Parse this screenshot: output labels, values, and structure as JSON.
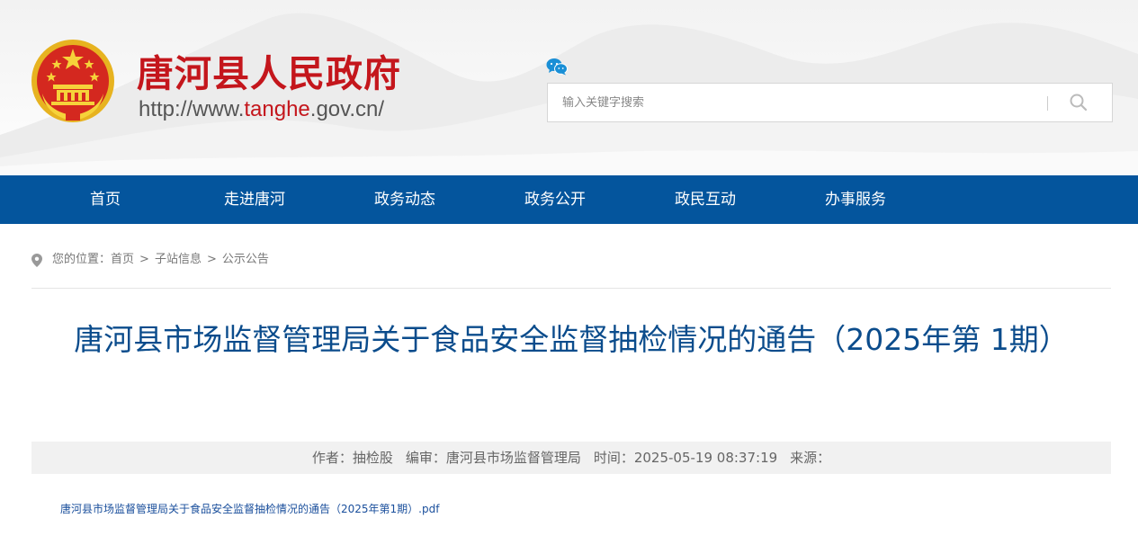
{
  "header": {
    "site_name": "唐河县人民政府",
    "url_prefix": "http://www.",
    "url_highlight": "tanghe",
    "url_suffix": ".gov.cn/",
    "search": {
      "placeholder": "输入关键字搜索"
    }
  },
  "icons": {
    "emblem": "national-emblem-icon",
    "wechat": "wechat-icon",
    "search": "search-icon",
    "location": "location-pin-icon"
  },
  "colors": {
    "brand_red": "#c4161c",
    "nav_blue": "#04559d",
    "title_blue": "#0b4c8c",
    "link_blue": "#1a4f9c"
  },
  "nav": {
    "items": [
      {
        "label": "首页"
      },
      {
        "label": "走进唐河"
      },
      {
        "label": "政务动态"
      },
      {
        "label": "政务公开"
      },
      {
        "label": "政民互动"
      },
      {
        "label": "办事服务"
      }
    ]
  },
  "breadcrumb": {
    "prefix": "您的位置：",
    "items": [
      "首页",
      "子站信息",
      "公示公告"
    ],
    "separator": ">"
  },
  "article": {
    "title": "唐河县市场监督管理局关于食品安全监督抽检情况的通告（2025年第 1期）",
    "meta": {
      "author": "作者：抽检股",
      "editor": "编审：唐河县市场监督管理局",
      "time": "时间：2025-05-19 08:37:19",
      "source": "来源："
    },
    "attachment": "唐河县市场监督管理局关于食品安全监督抽检情况的通告（2025年第1期）.pdf"
  }
}
